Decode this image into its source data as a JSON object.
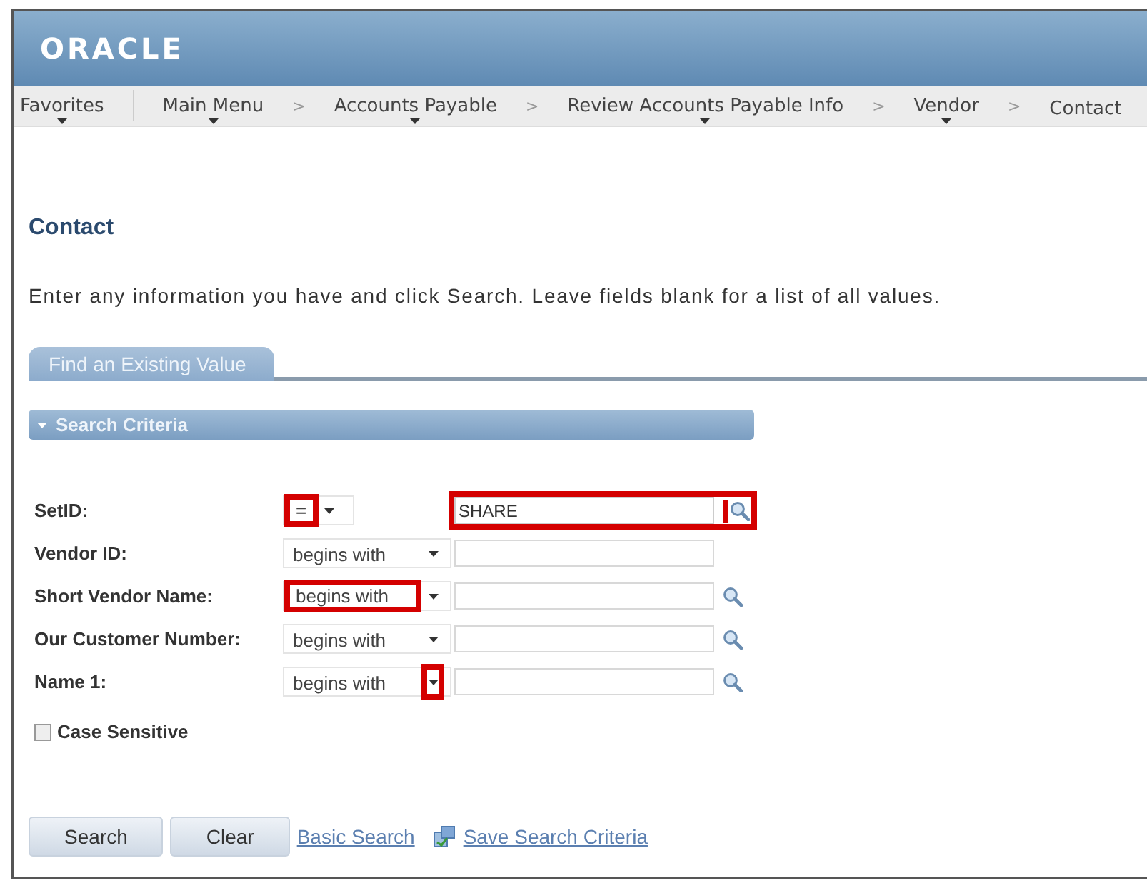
{
  "header": {
    "logo": "ORACLE"
  },
  "breadcrumbs": [
    {
      "label": "Favorites",
      "dropdown": true
    },
    {
      "label": "Main Menu",
      "dropdown": true
    },
    {
      "label": "Accounts Payable",
      "dropdown": true
    },
    {
      "label": "Review Accounts Payable Info",
      "dropdown": true
    },
    {
      "label": "Vendor",
      "dropdown": true
    },
    {
      "label": "Contact",
      "dropdown": false
    }
  ],
  "separator": ">",
  "page_title": "Contact",
  "instructions": "Enter any information you have and click Search. Leave fields blank for a list of all values.",
  "tabs": [
    {
      "label": "Find an Existing Value",
      "selected": true
    }
  ],
  "section": {
    "title": "Search Criteria",
    "expanded": true
  },
  "fields": [
    {
      "label": "SetID:",
      "operator": "=",
      "value": "SHARE",
      "lookup": true,
      "operator_highlighted": true,
      "arrow_highlighted": false,
      "value_highlighted": true
    },
    {
      "label": "Vendor ID:",
      "operator": "begins with",
      "lookup": false,
      "operator_highlighted": false,
      "arrow_highlighted": false,
      "value_highlighted": false
    },
    {
      "label": "Short Vendor Name:",
      "operator": "begins with",
      "lookup": true,
      "operator_highlighted": true,
      "arrow_highlighted": false,
      "value_highlighted": false
    },
    {
      "label": "Our Customer Number:",
      "operator": "begins with",
      "lookup": true,
      "operator_highlighted": false,
      "arrow_highlighted": false,
      "value_highlighted": false
    },
    {
      "label": "Name 1:",
      "operator": "begins with",
      "lookup": true,
      "operator_highlighted": false,
      "arrow_highlighted": true,
      "value_highlighted": false
    }
  ],
  "case_sensitive": {
    "label": "Case Sensitive",
    "checked": false
  },
  "buttons": [
    "Search",
    "Clear"
  ],
  "links": [
    {
      "label": "Basic Search",
      "icon": false
    },
    {
      "label": "Save Search Criteria",
      "icon": true
    }
  ]
}
